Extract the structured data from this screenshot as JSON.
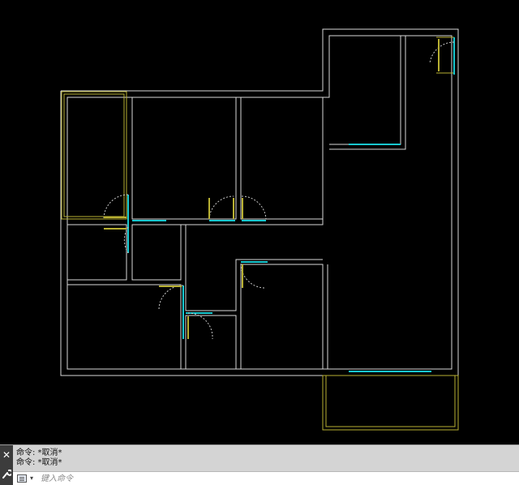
{
  "command_history": [
    "命令: *取消*",
    "命令: *取消*"
  ],
  "command_input": {
    "placeholder": "键入命令",
    "value": ""
  },
  "icons": {
    "close": "close-icon",
    "customize": "wrench-icon",
    "prompt": "command-prompt-icon",
    "dropdown": "chevron-down-icon"
  },
  "colors": {
    "canvas_background": "#000000",
    "wall_lines": "#d8d8d8",
    "balcony_lines": "#b8b032",
    "window_doors": "#18c8d0",
    "door_swing": "#c8c8c8",
    "panel_background": "#d4d4d4"
  }
}
